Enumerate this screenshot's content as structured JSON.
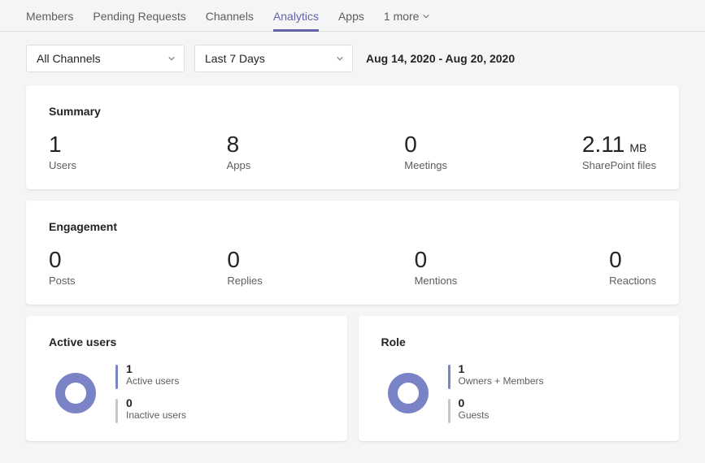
{
  "tabs": {
    "members": "Members",
    "pending": "Pending Requests",
    "channels": "Channels",
    "analytics": "Analytics",
    "apps": "Apps",
    "more": "1 more"
  },
  "filters": {
    "channels_value": "All Channels",
    "period_value": "Last 7 Days",
    "date_range": "Aug 14, 2020 - Aug 20, 2020"
  },
  "summary": {
    "title": "Summary",
    "users": {
      "value": "1",
      "label": "Users"
    },
    "apps": {
      "value": "8",
      "label": "Apps"
    },
    "meetings": {
      "value": "0",
      "label": "Meetings"
    },
    "files": {
      "value": "2.11",
      "unit": "MB",
      "label": "SharePoint files"
    }
  },
  "engagement": {
    "title": "Engagement",
    "posts": {
      "value": "0",
      "label": "Posts"
    },
    "replies": {
      "value": "0",
      "label": "Replies"
    },
    "mentions": {
      "value": "0",
      "label": "Mentions"
    },
    "reactions": {
      "value": "0",
      "label": "Reactions"
    }
  },
  "active_users": {
    "title": "Active users",
    "active": {
      "value": "1",
      "label": "Active users"
    },
    "inactive": {
      "value": "0",
      "label": "Inactive users"
    }
  },
  "role": {
    "title": "Role",
    "owners": {
      "value": "1",
      "label": "Owners + Members"
    },
    "guests": {
      "value": "0",
      "label": "Guests"
    }
  },
  "chart_data": [
    {
      "type": "pie",
      "title": "Active users",
      "categories": [
        "Active users",
        "Inactive users"
      ],
      "values": [
        1,
        0
      ],
      "colors": [
        "#7b83c7",
        "#c8c6c4"
      ]
    },
    {
      "type": "pie",
      "title": "Role",
      "categories": [
        "Owners + Members",
        "Guests"
      ],
      "values": [
        1,
        0
      ],
      "colors": [
        "#7b83c7",
        "#c8c6c4"
      ]
    }
  ]
}
